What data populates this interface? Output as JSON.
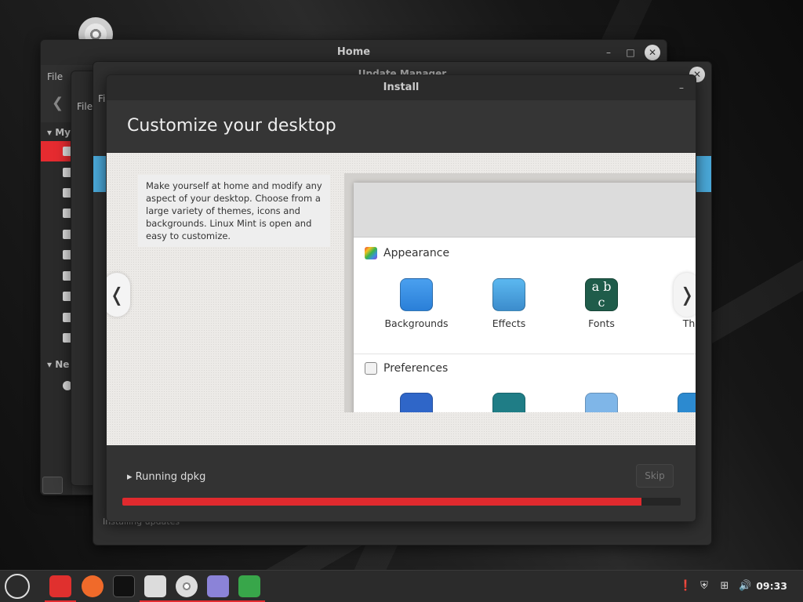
{
  "desktop": {},
  "home_window": {
    "title": "Home",
    "menu_file": "File",
    "sidebar_sections": [
      "My",
      "Ne"
    ]
  },
  "second_window": {
    "menu_file": "File"
  },
  "update_window": {
    "title": "Update Manager",
    "menu_file": "Fi",
    "status": "Installing updates"
  },
  "install_window": {
    "title": "Install",
    "minimize": "–",
    "close": "✕",
    "heading": "Customize your desktop",
    "description": "Make yourself at home and modify any aspect of your desktop. Choose from a large variety of themes, icons and backgrounds. Linux Mint is open and easy to customize.",
    "slide": {
      "appearance_label": "Appearance",
      "preferences_label": "Preferences",
      "items": [
        {
          "label": "Backgrounds"
        },
        {
          "label": "Effects"
        },
        {
          "label": "Fonts"
        },
        {
          "label": "Ther"
        }
      ],
      "prev_arrow": "❬",
      "next_arrow": "❭"
    },
    "progress_label": "Running dpkg",
    "skip_label": "Skip",
    "progress_fraction": 0.93
  },
  "taskbar": {
    "clock": "09:33",
    "accent": "#e52b30"
  }
}
